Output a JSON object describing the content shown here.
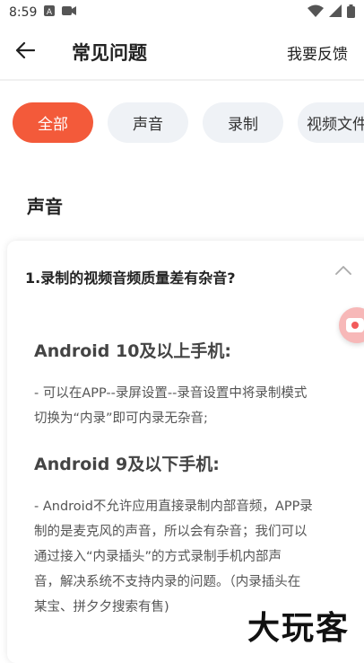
{
  "status": {
    "time": "8:59",
    "icons": [
      "a-notification-icon",
      "video-notification-icon",
      "wifi-icon",
      "signal-icon",
      "battery-icon"
    ]
  },
  "header": {
    "title": "常见问题",
    "feedback_label": "我要反馈"
  },
  "tabs": [
    {
      "label": "全部",
      "active": true
    },
    {
      "label": "声音",
      "active": false
    },
    {
      "label": "录制",
      "active": false
    },
    {
      "label": "视频文件",
      "active": false
    }
  ],
  "section": {
    "title": "声音"
  },
  "faq": {
    "question": "1.录制的视频音频质量差有杂音?",
    "blocks": [
      {
        "heading": "Android 10及以上手机:",
        "lines": [
          "- 可以在APP--录屏设置--录音设置中将录制模式",
          "切换为“内录”即可内录无杂音;"
        ]
      },
      {
        "heading": "Android 9及以下手机:",
        "lines": [
          "- Android不允许应用直接录制内部音频，APP录",
          "制的是麦克风的声音，所以会有杂音；我们可以",
          "通过接入“内录插头”的方式录制手机内部声",
          "音，解决系统不支持内录的问题。（内录插头在",
          "某宝、拼夕夕搜索有售)"
        ]
      }
    ]
  },
  "watermark": "大玩客",
  "colors": {
    "accent": "#f35a3a",
    "tab_bg": "#eff2f6",
    "float_btn": "#f7b8b8"
  }
}
